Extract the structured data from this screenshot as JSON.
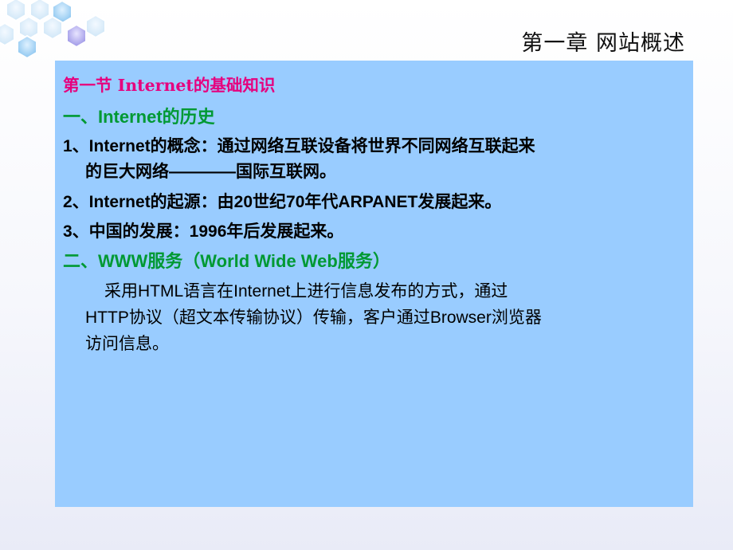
{
  "header": {
    "chapter_title": "第一章  网站概述"
  },
  "content": {
    "section_heading": "第一节 Internet的基础知识",
    "sub1_heading": "一、Internet的历史",
    "items": [
      {
        "line1": "1、Internet的概念：通过网络互联设备将世界不同网络互联起来",
        "line2": "的巨大网络————国际互联网。"
      },
      {
        "line1": "2、Internet的起源：由20世纪70年代ARPANET发展起来。"
      },
      {
        "line1": "3、中国的发展：1996年后发展起来。"
      }
    ],
    "sub2_heading": "二、WWW服务（World Wide Web服务）",
    "paragraph_lines": [
      "采用HTML语言在Internet上进行信息发布的方式，通过",
      "HTTP协议（超文本传输协议）传输，客户通过Browser浏览器",
      "访问信息。"
    ]
  },
  "colors": {
    "panel_bg": "#99ccff",
    "heading_magenta": "#e6007e",
    "subheading_green": "#009933",
    "body_text": "#000000"
  },
  "icons": {
    "decoration": "hexagon-cluster-decoration"
  }
}
